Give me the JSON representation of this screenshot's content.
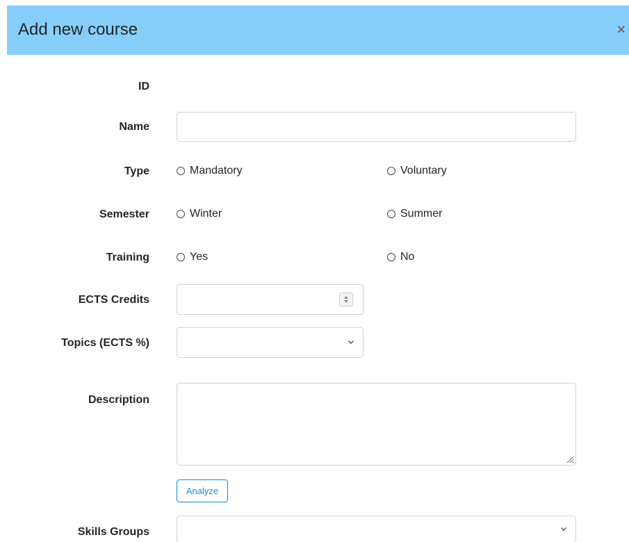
{
  "modal": {
    "title": "Add new course",
    "close_symbol": "×"
  },
  "form": {
    "id": {
      "label": "ID"
    },
    "name": {
      "label": "Name",
      "value": "",
      "placeholder": ""
    },
    "type": {
      "label": "Type",
      "options": [
        "Mandatory",
        "Voluntary"
      ],
      "selected": null
    },
    "semester": {
      "label": "Semester",
      "options": [
        "Winter",
        "Summer"
      ],
      "selected": null
    },
    "training": {
      "label": "Training",
      "options": [
        "Yes",
        "No"
      ],
      "selected": null
    },
    "ects_credits": {
      "label": "ECTS Credits",
      "value": ""
    },
    "topics": {
      "label": "Topics (ECTS %)",
      "selected": ""
    },
    "description": {
      "label": "Description",
      "value": ""
    },
    "analyze_button": {
      "label": "Analyze"
    },
    "skills_groups": {
      "label": "Skills Groups",
      "selected": ""
    }
  },
  "colors": {
    "header_bg": "#87cefa",
    "accent": "#1a8fd6",
    "border": "#ced4da"
  },
  "icons": {
    "close": "close-icon",
    "dropdown": "chevron-down-icon",
    "spinner": "spinner-arrows-icon",
    "resize": "resize-grip-icon"
  }
}
